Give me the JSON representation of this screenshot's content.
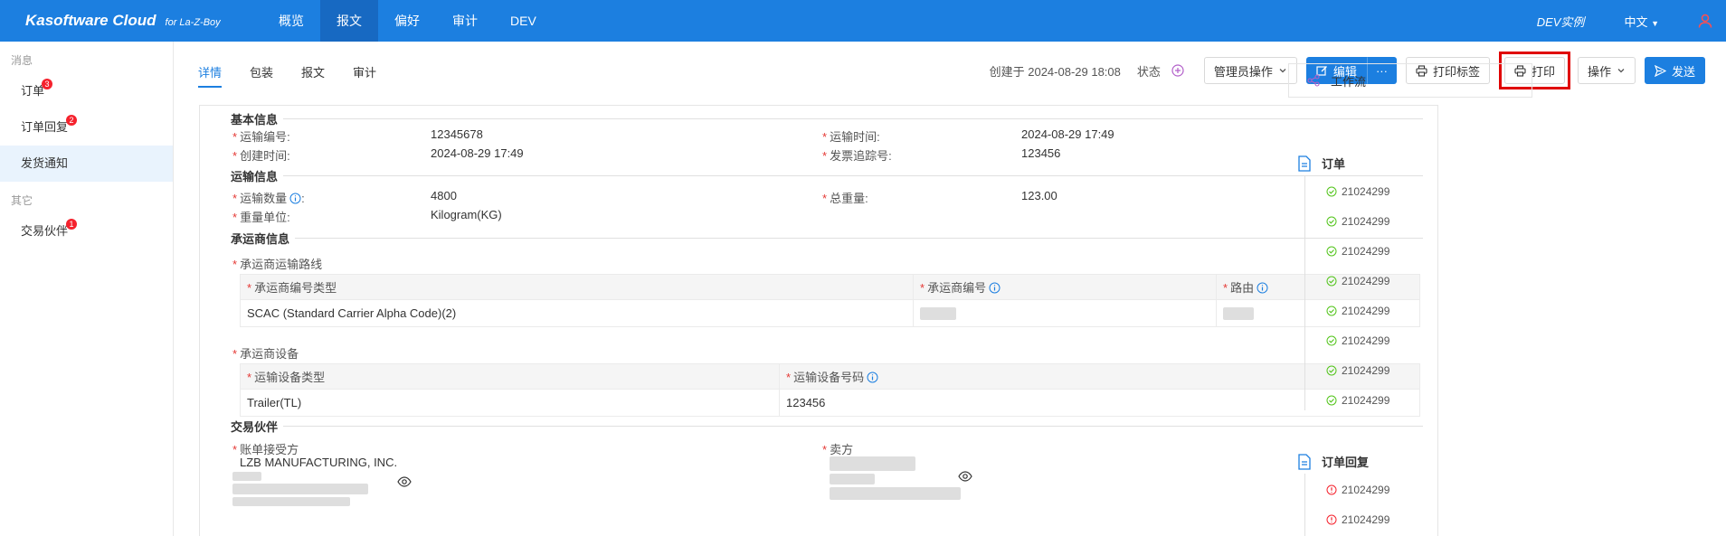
{
  "header": {
    "brand": "Kasoftware Cloud",
    "brand_sub": "for La-Z-Boy",
    "nav": [
      "概览",
      "报文",
      "偏好",
      "审计",
      "DEV"
    ],
    "instance": "DEV实例",
    "language": "中文"
  },
  "sidebar": {
    "group_messages": "消息",
    "items": [
      {
        "label": "订单",
        "badge": "3"
      },
      {
        "label": "订单回复",
        "badge": "2"
      },
      {
        "label": "发货通知",
        "badge": ""
      }
    ],
    "group_other": "其它",
    "other_items": [
      {
        "label": "交易伙伴",
        "badge": "1"
      }
    ]
  },
  "tabs": [
    "详情",
    "包装",
    "报文",
    "审计"
  ],
  "toolbar": {
    "created": "创建于 2024-08-29 18:08",
    "status_label": "状态",
    "admin_ops": "管理员操作",
    "edit": "编辑",
    "more": "···",
    "print_label": "打印标签",
    "print": "打印",
    "ops": "操作",
    "send": "发送"
  },
  "sections": {
    "basic": {
      "title": "基本信息",
      "shipment_no_label": "运输编号:",
      "shipment_no": "12345678",
      "ship_time_label": "运输时间:",
      "ship_time": "2024-08-29 17:49",
      "created_label": "创建时间:",
      "created": "2024-08-29 17:49",
      "invoice_label": "发票追踪号:",
      "invoice": "123456"
    },
    "transport": {
      "title": "运输信息",
      "qty_label": "运输数量",
      "qty": "4800",
      "weight_label": "总重量:",
      "weight": "123.00",
      "unit_label": "重量单位:",
      "unit": "Kilogram(KG)"
    },
    "carrier": {
      "title": "承运商信息",
      "route_label": "承运商运输路线",
      "route_cols": [
        "承运商编号类型",
        "承运商编号",
        "路由"
      ],
      "route_rows": [
        [
          "SCAC (Standard Carrier Alpha Code)(2)",
          "",
          ""
        ]
      ],
      "equip_label": "承运商设备",
      "equip_cols": [
        "运输设备类型",
        "运输设备号码"
      ],
      "equip_rows": [
        [
          "Trailer(TL)",
          "123456"
        ]
      ]
    },
    "partners": {
      "title": "交易伙伴",
      "bill_to_label": "账单接受方",
      "bill_to_name": "LZB MANUFACTURING, INC.",
      "seller_label": "卖方"
    }
  },
  "workflow": {
    "button": "工作流",
    "groups": [
      {
        "title": "订单",
        "items": [
          "21024299",
          "21024299",
          "21024299",
          "21024299",
          "21024299",
          "21024299",
          "21024299",
          "21024299"
        ]
      },
      {
        "title": "订单回复",
        "items": [
          "21024299",
          "21024299"
        ]
      }
    ]
  },
  "colors": {
    "primary": "#1c7fe0",
    "highlight": "#e00000",
    "success": "#52c41a",
    "error": "#f5222d"
  }
}
